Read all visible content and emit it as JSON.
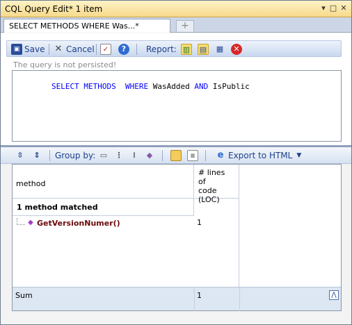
{
  "window": {
    "title": "CQL Query Edit* 1 item",
    "btn_dropdown": "▾",
    "btn_maximize": "□",
    "btn_close": "✕"
  },
  "tabs": {
    "active_label": "SELECT METHODS  WHERE Was...*",
    "new_tab_glyph": "+"
  },
  "toolbar": {
    "save_label": "Save",
    "cancel_label": "Cancel",
    "report_label": "Report:"
  },
  "editor": {
    "status_note": "The query is not persisted!",
    "query_tokens": [
      {
        "text": "SELECT",
        "kind": "kw"
      },
      {
        "text": " ",
        "kind": "id"
      },
      {
        "text": "METHODS",
        "kind": "kw"
      },
      {
        "text": "  ",
        "kind": "id"
      },
      {
        "text": "WHERE",
        "kind": "kw"
      },
      {
        "text": " WasAdded ",
        "kind": "id"
      },
      {
        "text": "AND",
        "kind": "kw"
      },
      {
        "text": " IsPublic",
        "kind": "id"
      }
    ]
  },
  "results_toolbar": {
    "group_by_label": "Group by:",
    "export_label": "Export to HTML"
  },
  "grid": {
    "col_method": "method",
    "col_loc": "# lines of code (LOC)",
    "col_loc_lines": [
      "# lines of",
      "code",
      "(LOC)"
    ],
    "group_label": "1 method matched",
    "rows": [
      {
        "method": "GetVersionNumer()",
        "loc": "1"
      }
    ],
    "sum_label": "Sum",
    "sum_value": "1"
  },
  "colors": {
    "keyword": "#0000ff",
    "method_name": "#6a0a0a",
    "title_bar": "#f7d98a"
  }
}
